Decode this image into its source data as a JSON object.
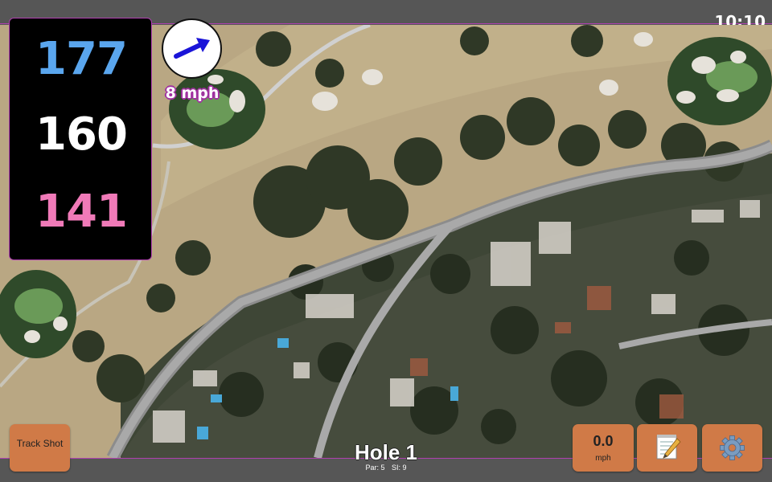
{
  "status": {
    "time": "10:10"
  },
  "distances": {
    "back": "177",
    "middle": "160",
    "front": "141"
  },
  "wind": {
    "speed": "8 mph",
    "icon": "wind-direction-arrow-icon"
  },
  "hole": {
    "title": "Hole 1",
    "par": "Par: 5",
    "si": "SI: 9"
  },
  "buttons": {
    "track_shot": "Track Shot",
    "speed_value": "0.0",
    "speed_unit": "mph",
    "notes_icon": "notepad-pencil-icon",
    "settings_icon": "gear-icon"
  },
  "colors": {
    "back": "#5aa6ee",
    "middle": "#ffffff",
    "front": "#f07ab8",
    "button": "#d07a47",
    "accent": "#b040b0"
  }
}
